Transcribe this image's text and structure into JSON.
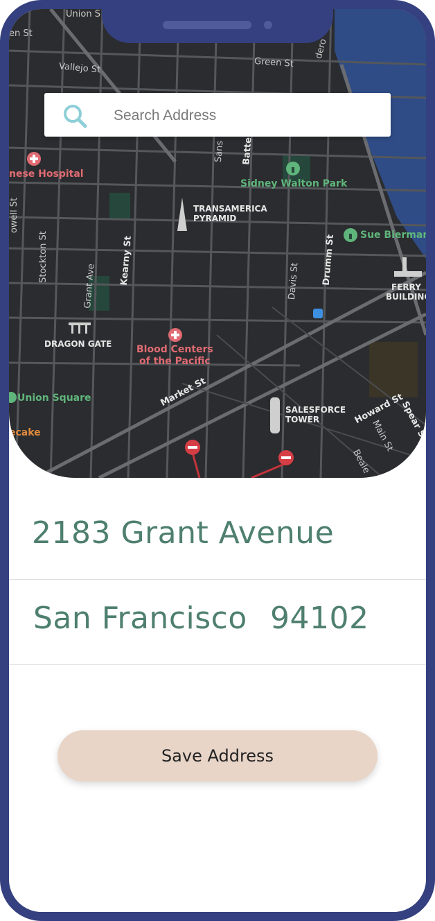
{
  "search": {
    "placeholder": "Search Address"
  },
  "map": {
    "labels": {
      "union_st": "Union S",
      "green_st_left": "en St",
      "vallejo_st": "Vallejo St",
      "green_st": "Green St",
      "dero": "dero",
      "hospital": "nese Hospital",
      "sidney_walton": "Sidney Walton Park",
      "transamerica": "TRANSAMERICA",
      "pyramid": "PYRAMID",
      "sue_bierman": "Sue Bierman",
      "ferry": "FERRY",
      "building": "BUILDING",
      "stockton": "Stockton St",
      "grant_ave": "Grant Ave",
      "kearny": "Kearny St",
      "davis": "Davis St",
      "drumm": "Drumm St",
      "battery": "Batte",
      "sansome": "Sans",
      "dragon_gate": "DRAGON GATE",
      "blood_centers_1": "Blood Centers",
      "blood_centers_2": "of the Pacific",
      "union_square": "Union Square",
      "market_st": "Market St",
      "salesforce_1": "SALESFORCE",
      "salesforce_2": "TOWER",
      "howard_st": "Howard St",
      "main_st": "Main St",
      "spear_st": "Spear S",
      "beale": "Beale",
      "cheesecake_1": "ecake",
      "powell": "owell St"
    },
    "colors": {
      "background": "#2b2c2f",
      "water": "#2f4c86",
      "road": "#5a5c60",
      "park": "#26473b"
    }
  },
  "address": {
    "street": "2183 Grant Avenue",
    "city": "San Francisco",
    "zip": "94102"
  },
  "actions": {
    "save_label": "Save Address"
  },
  "colors": {
    "frame": "#34407f",
    "text_accent": "#4e7f6f",
    "button": "#e8d5c8",
    "icon": "#8ecfd8"
  }
}
